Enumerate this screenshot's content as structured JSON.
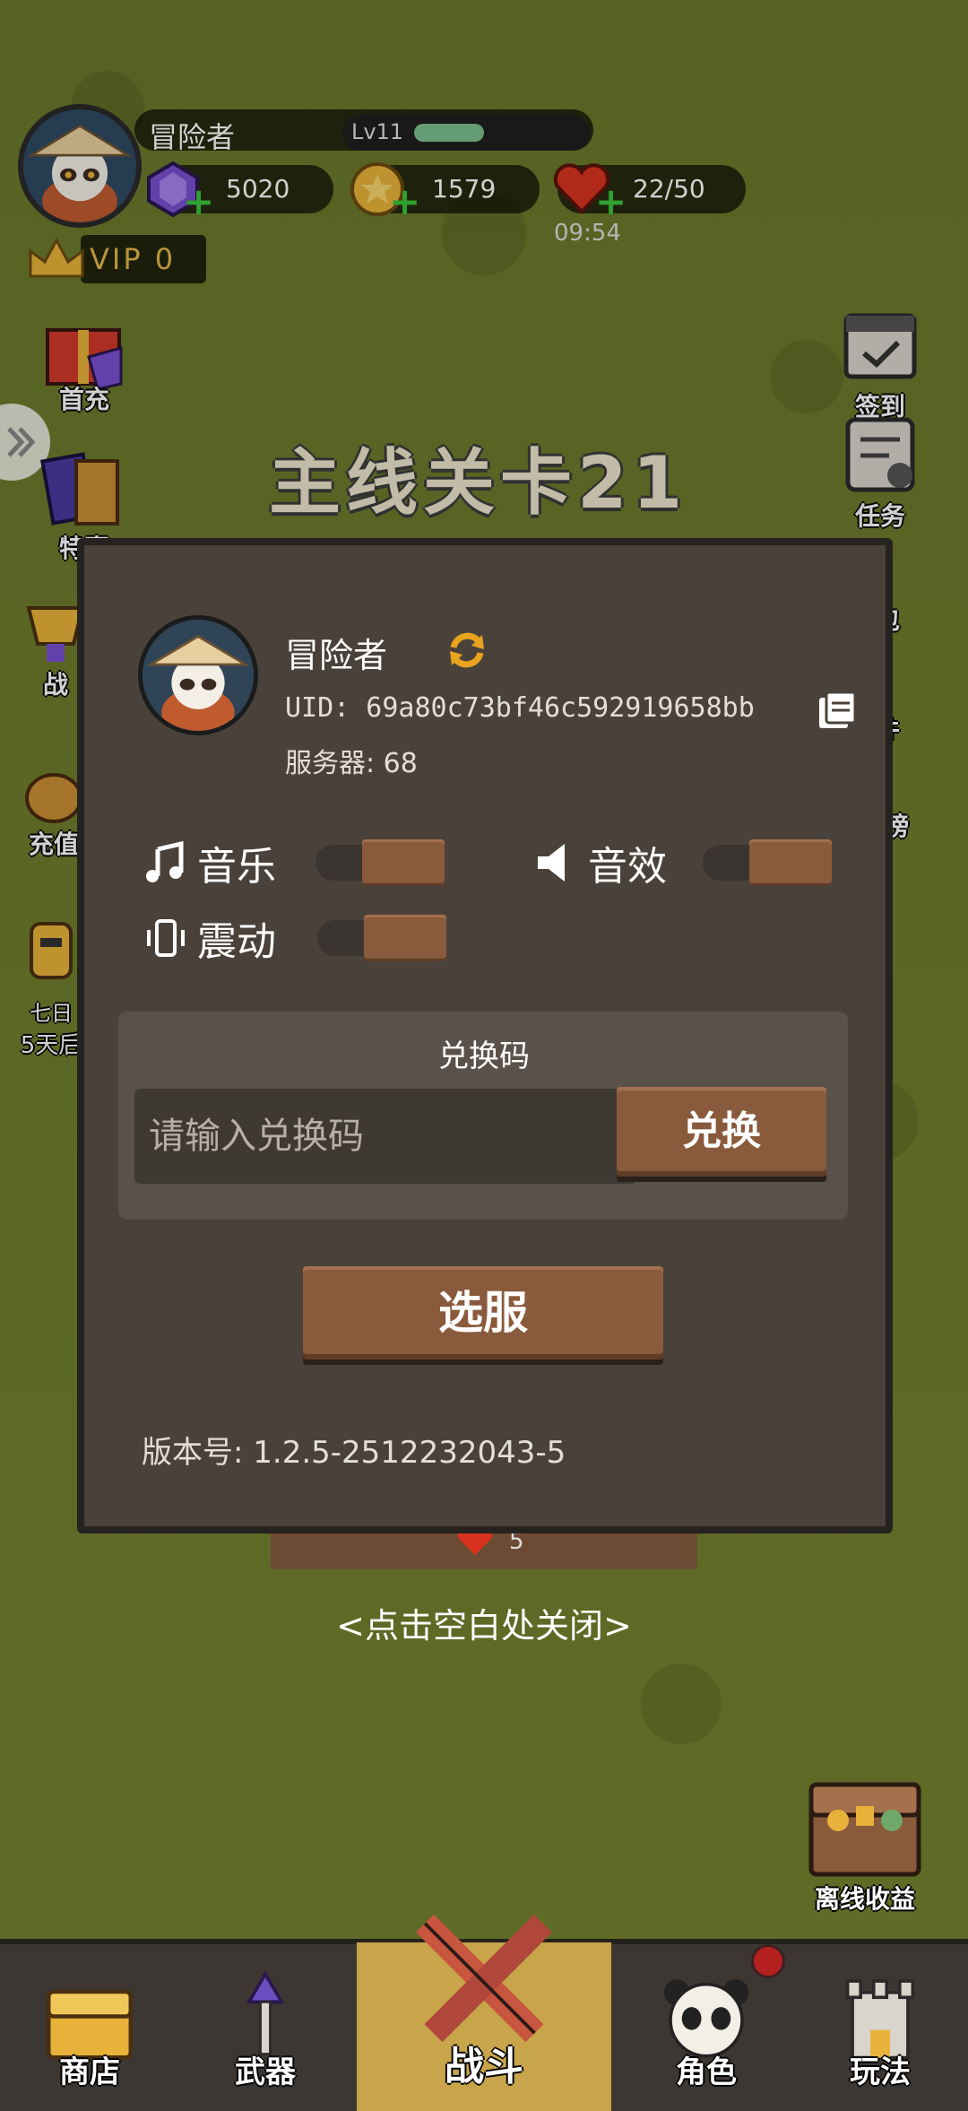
{
  "player": {
    "name": "冒险者",
    "level": "Lv11",
    "level_progress": 0.3
  },
  "resources": {
    "gems": "5020",
    "coins": "1579",
    "stamina": "22/50",
    "stamina_timer": "09:54"
  },
  "vip": {
    "label": "VIP 0"
  },
  "left_menu": {
    "first_recharge": "首充",
    "special": "特惠",
    "battle": "战",
    "recharge": "充值",
    "seven_day_1": "七日",
    "seven_day_2": "5天后"
  },
  "stage_title": "主线关卡21",
  "right_menu": {
    "checkin": "签到",
    "tasks": "任务",
    "bag": "包",
    "mail": "件",
    "rank": "榜"
  },
  "settings_modal": {
    "name": "冒险者",
    "uid": "UID: 69a80c73bf46c592919658bb",
    "server": "服务器: 68",
    "music_label": "音乐",
    "sfx_label": "音效",
    "vibrate_label": "震动",
    "redeem_title": "兑换码",
    "redeem_placeholder": "请输入兑换码",
    "redeem_button": "兑换",
    "select_server_button": "选服",
    "version": "版本号: 1.2.5-2512232043-5"
  },
  "under_modal_count": "5",
  "close_hint": "<点击空白处关闭>",
  "offline_reward": "离线收益",
  "bottom_nav": {
    "shop": "商店",
    "weapon": "武器",
    "battle": "战斗",
    "role": "角色",
    "play": "玩法"
  },
  "colors": {
    "background": "#6f7d2c",
    "panel": "#4a423a",
    "wood": "#8a5a3c",
    "active_tab": "#c8a44a"
  }
}
